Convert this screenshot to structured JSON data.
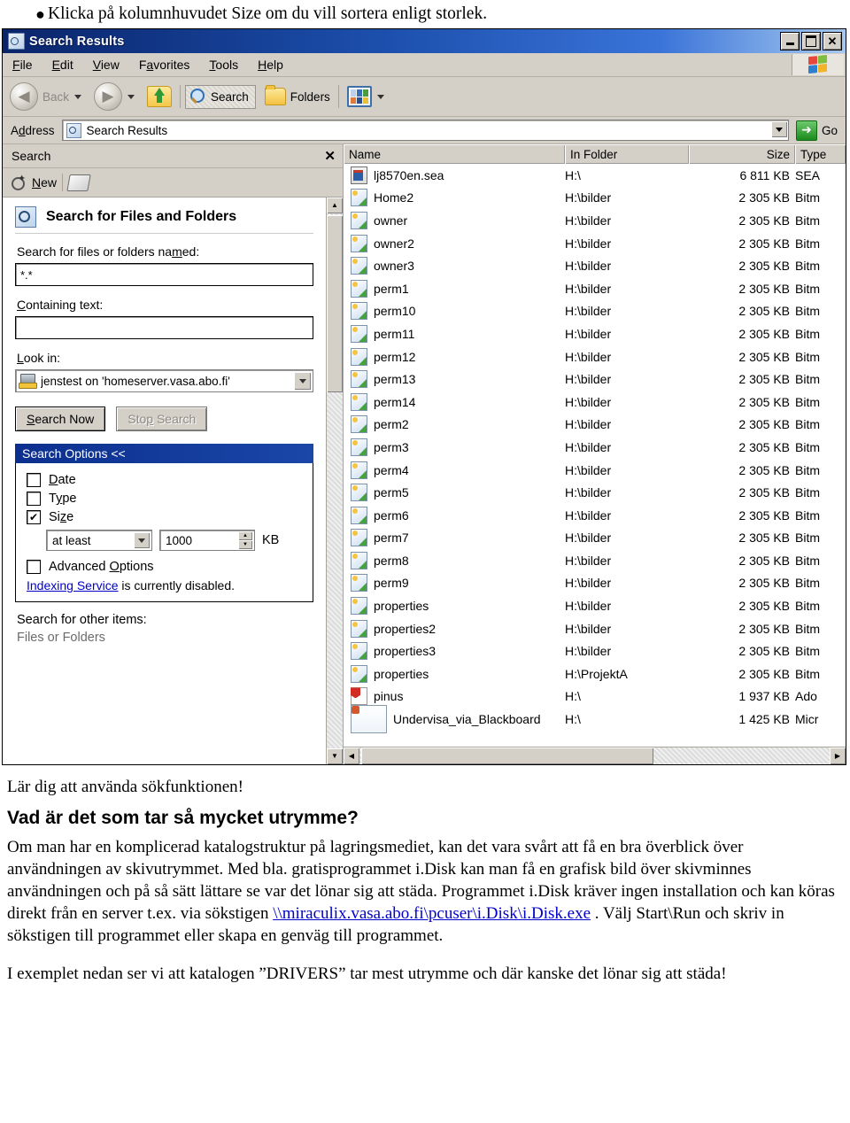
{
  "top_bullet": "Klicka på kolumnhuvudet Size om du vill sortera enligt storlek.",
  "window": {
    "title": "Search Results",
    "buttons": {
      "minimize": "_",
      "maximize": "□",
      "close": "✕"
    },
    "menu": [
      "File",
      "Edit",
      "View",
      "Favorites",
      "Tools",
      "Help"
    ],
    "toolbar": {
      "back": "Back",
      "forward": "",
      "up": "",
      "search": "Search",
      "folders": "Folders",
      "views": ""
    },
    "address": {
      "label": "Address",
      "value": "Search Results",
      "go": "Go"
    }
  },
  "sidebar": {
    "title": "Search",
    "close": "✕",
    "new_button": "New",
    "heading": "Search for Files and Folders",
    "named_label": "Search for files or folders named:",
    "named_value": "*.*",
    "containing_label": "Containing text:",
    "containing_value": "",
    "lookin_label": "Look in:",
    "lookin_value": "jenstest on 'homeserver.vasa.abo.fi'",
    "search_now": "Search Now",
    "stop_search": "Stop Search",
    "options_header": "Search Options <<",
    "options": [
      {
        "label": "Date",
        "checked": false
      },
      {
        "label": "Type",
        "checked": false
      },
      {
        "label": "Size",
        "checked": true
      }
    ],
    "size_operator": "at least",
    "size_value": "1000",
    "size_unit": "KB",
    "advanced_label": "Advanced Options",
    "advanced_checked": false,
    "indexing_link": "Indexing Service",
    "indexing_rest": " is currently disabled.",
    "other_items_label": "Search for other items:",
    "other_items_first": "Files or Folders"
  },
  "filelist": {
    "columns": [
      "Name",
      "In Folder",
      "Size",
      "Type"
    ],
    "rows": [
      {
        "name": "lj8570en.sea",
        "folder": "H:\\",
        "size": "6 811 KB",
        "type": "SEA",
        "icon": "sea"
      },
      {
        "name": "Home2",
        "folder": "H:\\bilder",
        "size": "2 305 KB",
        "type": "Bitm",
        "icon": "bmp"
      },
      {
        "name": "owner",
        "folder": "H:\\bilder",
        "size": "2 305 KB",
        "type": "Bitm",
        "icon": "bmp"
      },
      {
        "name": "owner2",
        "folder": "H:\\bilder",
        "size": "2 305 KB",
        "type": "Bitm",
        "icon": "bmp"
      },
      {
        "name": "owner3",
        "folder": "H:\\bilder",
        "size": "2 305 KB",
        "type": "Bitm",
        "icon": "bmp"
      },
      {
        "name": "perm1",
        "folder": "H:\\bilder",
        "size": "2 305 KB",
        "type": "Bitm",
        "icon": "bmp"
      },
      {
        "name": "perm10",
        "folder": "H:\\bilder",
        "size": "2 305 KB",
        "type": "Bitm",
        "icon": "bmp"
      },
      {
        "name": "perm11",
        "folder": "H:\\bilder",
        "size": "2 305 KB",
        "type": "Bitm",
        "icon": "bmp"
      },
      {
        "name": "perm12",
        "folder": "H:\\bilder",
        "size": "2 305 KB",
        "type": "Bitm",
        "icon": "bmp"
      },
      {
        "name": "perm13",
        "folder": "H:\\bilder",
        "size": "2 305 KB",
        "type": "Bitm",
        "icon": "bmp"
      },
      {
        "name": "perm14",
        "folder": "H:\\bilder",
        "size": "2 305 KB",
        "type": "Bitm",
        "icon": "bmp"
      },
      {
        "name": "perm2",
        "folder": "H:\\bilder",
        "size": "2 305 KB",
        "type": "Bitm",
        "icon": "bmp"
      },
      {
        "name": "perm3",
        "folder": "H:\\bilder",
        "size": "2 305 KB",
        "type": "Bitm",
        "icon": "bmp"
      },
      {
        "name": "perm4",
        "folder": "H:\\bilder",
        "size": "2 305 KB",
        "type": "Bitm",
        "icon": "bmp"
      },
      {
        "name": "perm5",
        "folder": "H:\\bilder",
        "size": "2 305 KB",
        "type": "Bitm",
        "icon": "bmp"
      },
      {
        "name": "perm6",
        "folder": "H:\\bilder",
        "size": "2 305 KB",
        "type": "Bitm",
        "icon": "bmp"
      },
      {
        "name": "perm7",
        "folder": "H:\\bilder",
        "size": "2 305 KB",
        "type": "Bitm",
        "icon": "bmp"
      },
      {
        "name": "perm8",
        "folder": "H:\\bilder",
        "size": "2 305 KB",
        "type": "Bitm",
        "icon": "bmp"
      },
      {
        "name": "perm9",
        "folder": "H:\\bilder",
        "size": "2 305 KB",
        "type": "Bitm",
        "icon": "bmp"
      },
      {
        "name": "properties",
        "folder": "H:\\bilder",
        "size": "2 305 KB",
        "type": "Bitm",
        "icon": "bmp"
      },
      {
        "name": "properties2",
        "folder": "H:\\bilder",
        "size": "2 305 KB",
        "type": "Bitm",
        "icon": "bmp"
      },
      {
        "name": "properties3",
        "folder": "H:\\bilder",
        "size": "2 305 KB",
        "type": "Bitm",
        "icon": "bmp"
      },
      {
        "name": "properties",
        "folder": "H:\\ProjektA",
        "size": "2 305 KB",
        "type": "Bitm",
        "icon": "bmp"
      },
      {
        "name": "pinus",
        "folder": "H:\\",
        "size": "1 937 KB",
        "type": "Ado",
        "icon": "pdf"
      },
      {
        "name": "Undervisa_via_Blackboard",
        "folder": "H:\\",
        "size": "1 425 KB",
        "type": "Micr",
        "icon": "doc"
      }
    ]
  },
  "document": {
    "lead": "Lär dig att använda sökfunktionen!",
    "heading": "Vad är det som tar så mycket utrymme?",
    "para1_a": "Om man har en komplicerad katalogstruktur på lagringsmediet, kan det vara svårt att få en bra överblick över användningen av skivutrymmet. Med bla. gratisprogrammet i.Disk kan man få en grafisk bild över skivminnes användningen och på så sätt lättare se var det lönar sig att städa. Programmet i.Disk kräver ingen installation och kan köras direkt från en server t.ex. via sökstigen ",
    "link": "\\\\miraculix.vasa.abo.fi\\pcuser\\i.Disk\\i.Disk.exe",
    "para1_b": " . Välj Start\\Run och skriv in sökstigen till programmet eller skapa en genväg till programmet.",
    "para2": "I exemplet nedan ser vi att katalogen ”DRIVERS” tar mest utrymme och där kanske det lönar sig att städa!"
  }
}
